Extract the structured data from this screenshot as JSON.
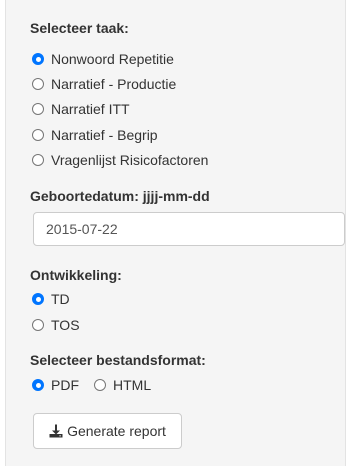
{
  "task": {
    "label": "Selecteer taak:",
    "options": [
      "Nonwoord Repetitie",
      "Narratief - Productie",
      "Narratief ITT",
      "Narratief - Begrip",
      "Vragenlijst Risicofactoren"
    ],
    "selected": "Nonwoord Repetitie"
  },
  "birthdate": {
    "label": "Geboortedatum: jjjj-mm-dd",
    "value": "2015-07-22"
  },
  "development": {
    "label": "Ontwikkeling:",
    "options": [
      "TD",
      "TOS"
    ],
    "selected": "TD"
  },
  "format": {
    "label": "Selecteer bestandsformat:",
    "options": [
      "PDF",
      "HTML"
    ],
    "selected": "PDF"
  },
  "generate_button": {
    "label": "Generate report",
    "icon": "download-icon"
  },
  "colors": {
    "accent": "#0075ff",
    "panel": "#f5f5f5"
  }
}
